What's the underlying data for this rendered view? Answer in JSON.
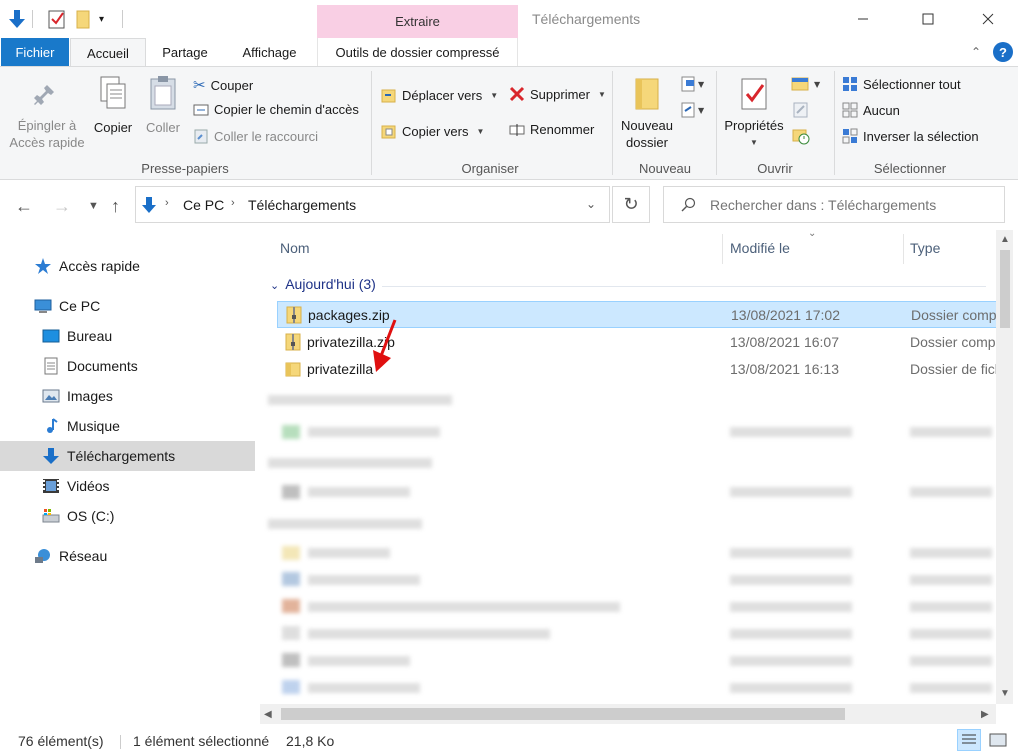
{
  "window": {
    "title": "Téléchargements",
    "context_group": "Extraire",
    "buttons": [
      "minimize",
      "maximize",
      "close"
    ]
  },
  "ribbon_tabs": {
    "file": "Fichier",
    "home": "Accueil",
    "share": "Partage",
    "view": "Affichage",
    "tools": "Outils de dossier compressé"
  },
  "ribbon": {
    "clipboard": {
      "pin": "Épingler à\nAccès rapide",
      "copy": "Copier",
      "paste": "Coller",
      "cut": "Couper",
      "copy_path": "Copier le chemin d'accès",
      "paste_shortcut": "Coller le raccourci",
      "label": "Presse-papiers"
    },
    "organize": {
      "move_to": "Déplacer vers",
      "copy_to": "Copier vers",
      "delete": "Supprimer",
      "rename": "Renommer",
      "label": "Organiser"
    },
    "new": {
      "new_folder": "Nouveau\ndossier",
      "label": "Nouveau"
    },
    "open": {
      "properties": "Propriétés",
      "label": "Ouvrir"
    },
    "select": {
      "select_all": "Sélectionner tout",
      "select_none": "Aucun",
      "invert": "Inverser la sélection",
      "label": "Sélectionner"
    }
  },
  "address": {
    "crumbs": [
      "Ce PC",
      "Téléchargements"
    ],
    "search_placeholder": "Rechercher dans : Téléchargements"
  },
  "nav": {
    "items": [
      {
        "label": "Accès rapide",
        "icon": "star-icon"
      },
      {
        "label": "Ce PC",
        "icon": "computer-icon"
      },
      {
        "label": "Bureau",
        "icon": "desktop-icon"
      },
      {
        "label": "Documents",
        "icon": "documents-icon"
      },
      {
        "label": "Images",
        "icon": "images-icon"
      },
      {
        "label": "Musique",
        "icon": "music-icon"
      },
      {
        "label": "Téléchargements",
        "icon": "download-icon",
        "selected": true
      },
      {
        "label": "Vidéos",
        "icon": "videos-icon"
      },
      {
        "label": "OS (C:)",
        "icon": "drive-icon"
      },
      {
        "label": "Réseau",
        "icon": "network-icon"
      }
    ]
  },
  "list": {
    "columns": [
      "Nom",
      "Modifié le",
      "Type"
    ],
    "group": "Aujourd'hui (3)",
    "rows": [
      {
        "name": "packages.zip",
        "date": "13/08/2021 17:02",
        "type": "Dossier compressé",
        "icon": "zip-icon",
        "selected": true
      },
      {
        "name": "privatezilla.zip",
        "date": "13/08/2021 16:07",
        "type": "Dossier compressé",
        "icon": "zip-icon"
      },
      {
        "name": "privatezilla",
        "date": "13/08/2021 16:13",
        "type": "Dossier de fichiers",
        "icon": "folder-icon"
      }
    ]
  },
  "status": {
    "count": "76 élément(s)",
    "selection": "1 élément sélectionné",
    "size": "21,8 Ko"
  },
  "colors": {
    "accent": "#1979ca",
    "selection": "#cce8ff",
    "context": "#f9cfe4",
    "annotation_arrow": "#e01010"
  }
}
